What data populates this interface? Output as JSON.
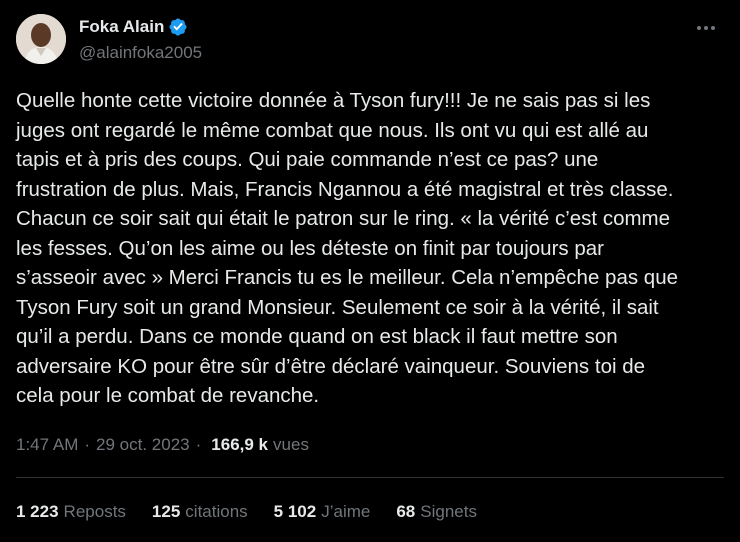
{
  "author": {
    "name": "Foka Alain",
    "handle": "@alainfoka2005",
    "verified_color": "#1d9bf0"
  },
  "tweet": {
    "text": "Quelle honte cette victoire donnée à Tyson fury!!! Je ne sais pas si les\njuges ont regardé le même combat que nous. Ils ont vu qui est allé au\ntapis et à pris des coups. Qui paie commande n’est ce pas? une\nfrustration de plus. Mais, Francis Ngannou a été magistral et très classe.\nChacun ce soir sait qui était le patron sur le ring. «  la vérité c’est comme\nles fesses. Qu’on les aime ou les déteste on finit par toujours par\ns’asseoir avec » Merci Francis tu es le meilleur. Cela n’empêche pas que\nTyson Fury soit un grand Monsieur. Seulement ce soir à la vérité, il sait\nqu’il a perdu. Dans ce monde quand on est black il faut mettre son\nadversaire KO pour être sûr d’être déclaré vainqueur.  Souviens toi de\ncela pour le combat de revanche."
  },
  "meta": {
    "time": "1:47 AM",
    "separator": "·",
    "date": "29 oct. 2023",
    "views_count": "166,9 k",
    "views_label": "vues"
  },
  "stats": {
    "reposts": {
      "count": "1 223",
      "label": "Reposts"
    },
    "quotes": {
      "count": "125",
      "label": "citations"
    },
    "likes": {
      "count": "5 102",
      "label": "J’aime"
    },
    "bookmarks": {
      "count": "68",
      "label": "Signets"
    }
  },
  "colors": {
    "background": "#000000",
    "text": "#e7e9ea",
    "secondary": "#71767b",
    "divider": "#2f3336"
  }
}
